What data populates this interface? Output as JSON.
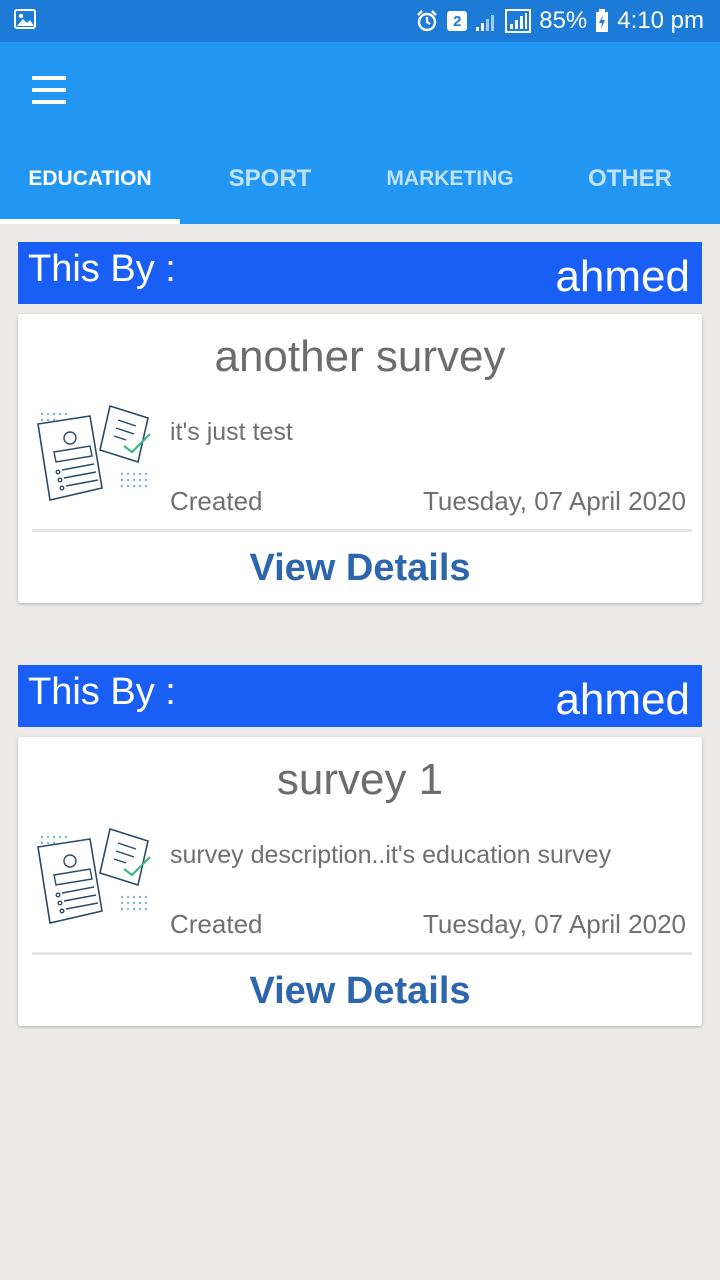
{
  "status_bar": {
    "battery": "85%",
    "time": "4:10 pm",
    "sim_badge": "2"
  },
  "tabs": [
    {
      "label": "EDUCATION",
      "active": true
    },
    {
      "label": "SPORT",
      "active": false
    },
    {
      "label": "MARKETING",
      "active": false
    },
    {
      "label": "OTHER",
      "active": false
    }
  ],
  "surveys": [
    {
      "by_label": "This By :",
      "author": "ahmed",
      "title": "another survey",
      "description": "it's just test",
      "created_label": "Created",
      "created_date": "Tuesday, 07 April 2020",
      "action_label": "View Details"
    },
    {
      "by_label": "This By :",
      "author": "ahmed",
      "title": "survey 1",
      "description": "survey description..it's education survey",
      "created_label": "Created",
      "created_date": "Tuesday, 07 April 2020",
      "action_label": "View Details"
    }
  ],
  "icons": {
    "menu": "hamburger-menu-icon",
    "illustration": "survey-documents-illustration"
  },
  "colors": {
    "app_bar": "#2196f3",
    "status_bar": "#1c7bd6",
    "banner": "#1a5ff5",
    "action": "#2e66ad"
  }
}
